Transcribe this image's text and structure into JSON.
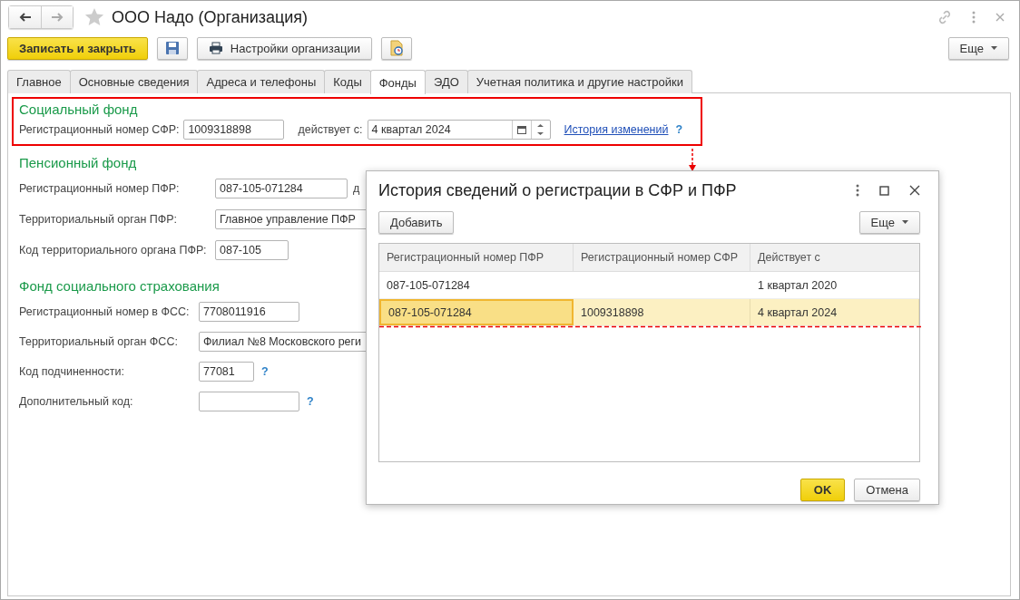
{
  "window": {
    "title": "ООО Надо (Организация)"
  },
  "toolbar": {
    "save_close": "Записать и закрыть",
    "settings": "Настройки организации",
    "more": "Еще"
  },
  "tabs": [
    {
      "label": "Главное",
      "selected": false
    },
    {
      "label": "Основные сведения",
      "selected": false
    },
    {
      "label": "Адреса и телефоны",
      "selected": false
    },
    {
      "label": "Коды",
      "selected": false
    },
    {
      "label": "Фонды",
      "selected": true
    },
    {
      "label": "ЭДО",
      "selected": false
    },
    {
      "label": "Учетная политика и другие настройки",
      "selected": false
    }
  ],
  "social_fund": {
    "heading": "Социальный фонд",
    "reg_label": "Регистрационный номер СФР:",
    "reg_value": "1009318898",
    "since_label": "действует с:",
    "since_value": "4 квартал 2024",
    "history_link": "История изменений",
    "help": "?"
  },
  "pension_fund": {
    "heading": "Пенсионный фонд",
    "fields": [
      {
        "label": "Регистрационный номер ПФР:",
        "value": "087-105-071284",
        "after": "д"
      },
      {
        "label": "Территориальный орган ПФР:",
        "value": "Главное управление ПФР"
      },
      {
        "label": "Код территориального органа ПФР:",
        "value": "087-105"
      }
    ]
  },
  "fss": {
    "heading": "Фонд социального страхования",
    "fields": [
      {
        "label": "Регистрационный номер в ФСС:",
        "value": "7708011916"
      },
      {
        "label": "Территориальный орган ФСС:",
        "value": "Филиал №8 Московского реги"
      },
      {
        "label": "Код подчиненности:",
        "value": "77081",
        "help": "?"
      },
      {
        "label": "Дополнительный код:",
        "help": "?"
      }
    ]
  },
  "dialog": {
    "title": "История сведений о регистрации в СФР и ПФР",
    "add": "Добавить",
    "more": "Еще",
    "columns": [
      "Регистрационный номер ПФР",
      "Регистрационный номер СФР",
      "Действует с"
    ],
    "rows": [
      {
        "cells": [
          "087-105-071284",
          "",
          "1 квартал 2020"
        ],
        "selected": false
      },
      {
        "cells": [
          "087-105-071284",
          "1009318898",
          "4 квартал 2024"
        ],
        "selected": true
      }
    ],
    "ok": "OK",
    "cancel": "Отмена"
  }
}
